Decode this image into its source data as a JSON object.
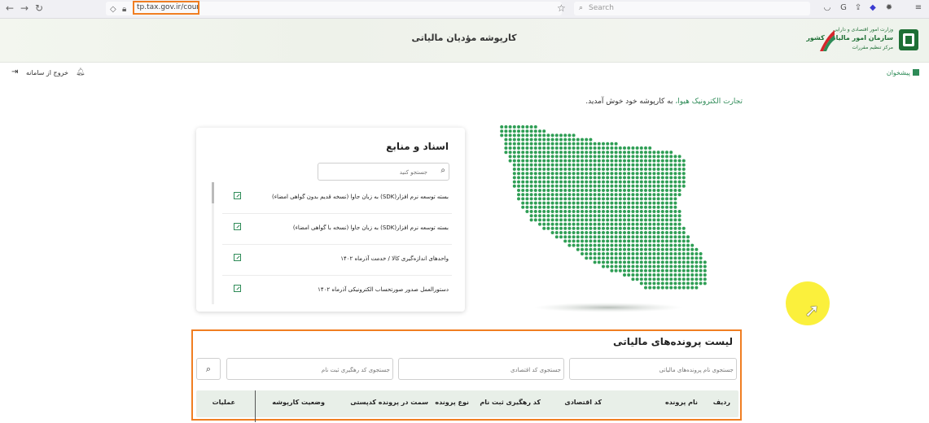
{
  "browser": {
    "url": "tp.tax.gov.ir/counter",
    "search_placeholder": "Search"
  },
  "header": {
    "title": "کارپوشه مؤدیان مالیاتی",
    "logo_line1": "وزارت امور اقتصادی و دارایی",
    "logo_line2": "سازمان امور مالیاتی کشور",
    "logo_line3": "مرکز تنظیم مقررات"
  },
  "topbar": {
    "logout_label": "خروج از سامانه",
    "suggest_label": "پیشخوان"
  },
  "welcome": {
    "company": "تجارت الکترونیک هیوا،",
    "message": "به کارپوشه خود خوش آمدید."
  },
  "docs": {
    "title": "اسناد و منابع",
    "search_placeholder": "جستجو کنید",
    "items": [
      {
        "label": "بسته توسعه نرم افزار(SDK) به زبان جاوا (نسخه قدیم بدون گواهی امضاء)"
      },
      {
        "label": "بسته توسعه نرم افزار(SDK) به زبان جاوا (نسخه با گواهی امضاء)"
      },
      {
        "label": "واحدهای اندازه‌گیری کالا / خدمت آذرماه ۱۴۰۲"
      },
      {
        "label": "دستورالعمل صدور صورتحساب الکترونیکی آذرماه ۱۴۰۲"
      }
    ]
  },
  "tax_files": {
    "title": "لیست پرونده‌های مالیاتی",
    "search_name_placeholder": "جستجوی نام پرونده‌های مالیاتی",
    "search_code_placeholder": "جستجوی کد اقتصادی",
    "search_tracking_placeholder": "جستجوی کد رهگیری ثبت نام",
    "columns": {
      "row": "ردیف",
      "name": "نام پرونده",
      "economic_code": "کد اقتصادی",
      "tracking_code": "کد رهگیری ثبت نام",
      "file_type": "نوع پرونده",
      "role": "سمت در پرونده",
      "postal_code": "کدپستی",
      "status": "وضعیت کارپوشه",
      "actions": "عملیات"
    }
  },
  "colors": {
    "brand_green": "#2e8b57",
    "highlight_orange": "#f07e22",
    "map_green": "#2f9e55",
    "cursor_highlight": "#fbef2b"
  }
}
